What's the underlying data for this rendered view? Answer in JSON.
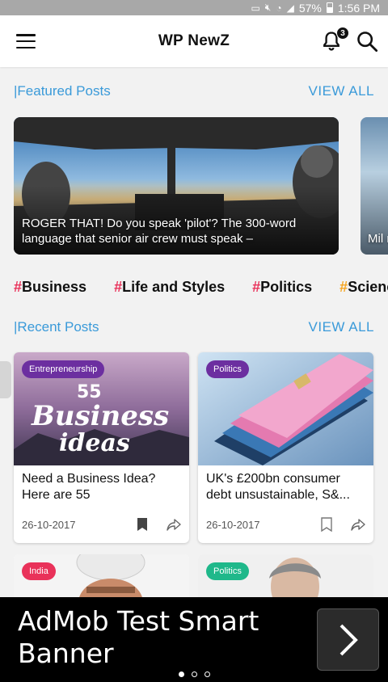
{
  "status_bar": {
    "battery": "57%",
    "time": "1:56 PM"
  },
  "app_bar": {
    "title": "WP NewZ",
    "notification_count": "3"
  },
  "featured": {
    "header": "|Featured Posts",
    "view_all": "VIEW ALL",
    "posts": [
      {
        "caption": "ROGER THAT! Do you speak 'pilot'? The 300-word language that senior air crew must speak –"
      },
      {
        "caption": "Mil ma"
      }
    ]
  },
  "categories": [
    {
      "hash": "#",
      "label": "Business",
      "hash_color": "#e9325a"
    },
    {
      "hash": "#",
      "label": "Life and Styles",
      "hash_color": "#e9325a"
    },
    {
      "hash": "#",
      "label": "Politics",
      "hash_color": "#e9325a"
    },
    {
      "hash": "#",
      "label": "Scienc",
      "hash_color": "#f5a623"
    }
  ],
  "recent": {
    "header": "|Recent Posts",
    "view_all": "VIEW ALL",
    "posts": [
      {
        "tag": "Entrepreneurship",
        "tag_color": "#6c2fa0",
        "title": "Need a Business Idea? Here are 55",
        "date": "26-10-2017",
        "image_text_1": "55",
        "image_text_2": "Business",
        "image_text_3": "ideas"
      },
      {
        "tag": "Politics",
        "tag_color": "#6c2fa0",
        "title": "UK's £200bn consumer debt unsustainable, S&...",
        "date": "26-10-2017"
      },
      {
        "tag": "India",
        "tag_color": "#e9325a"
      },
      {
        "tag": "Politics",
        "tag_color": "#1fb88a"
      }
    ]
  },
  "ad": {
    "text": "AdMob Test Smart Banner"
  },
  "colors": {
    "accent_blue": "#3a9ad9"
  }
}
